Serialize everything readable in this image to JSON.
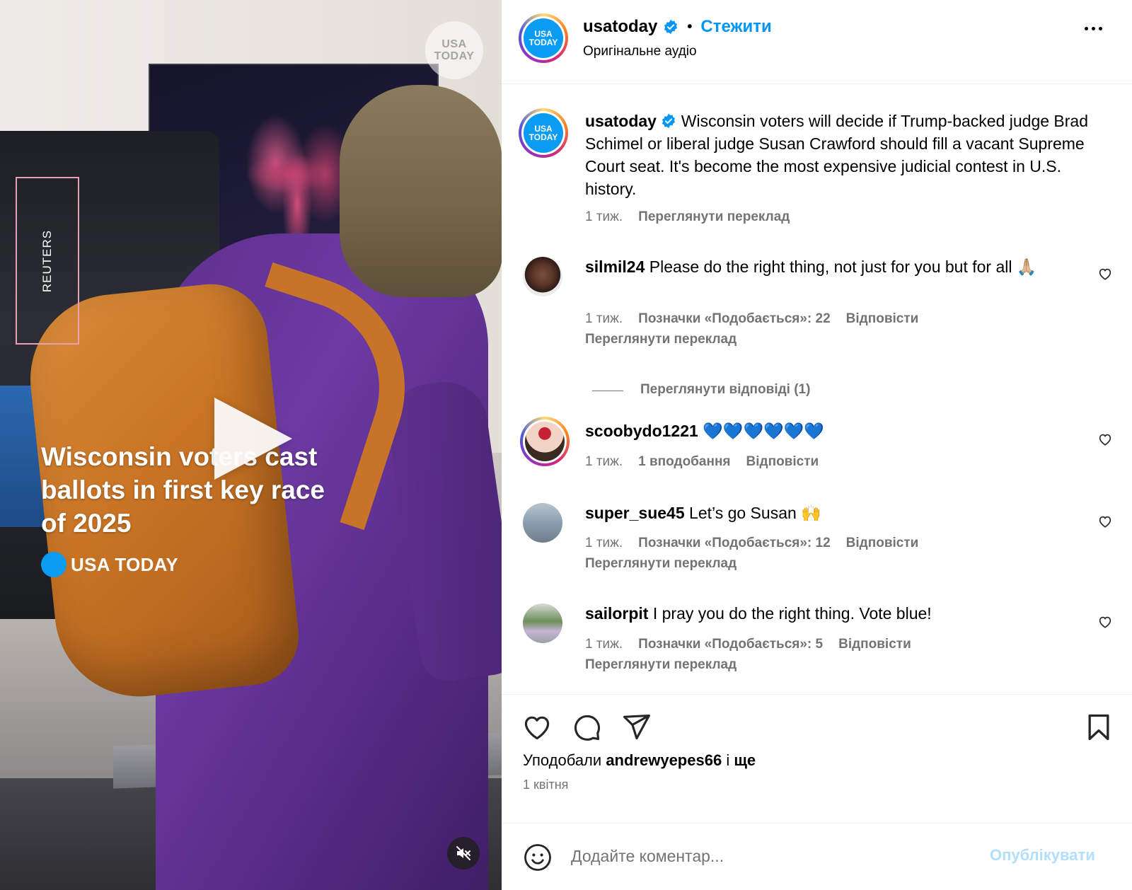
{
  "video": {
    "watermark_line1": "USA",
    "watermark_line2": "TODAY",
    "credit": "REUTERS",
    "headline": "Wisconsin voters cast ballots in first key race of 2025",
    "brand": "USA TODAY",
    "play_icon": "play-icon",
    "mute_icon": "muted-speaker-icon"
  },
  "header": {
    "username": "usatoday",
    "separator": "•",
    "follow_label": "Стежити",
    "subtitle": "Оригінальне аудіо",
    "avatar_line1": "USA",
    "avatar_line2": "TODAY",
    "more_icon": "more-options-icon"
  },
  "caption": {
    "username": "usatoday",
    "text": "Wisconsin voters will decide if Trump-backed judge Brad Schimel or liberal judge Susan Crawford should fill a vacant Supreme Court seat. It's become the most expensive judicial contest in U.S. history.",
    "time": "1 тиж.",
    "translate": "Переглянути переклад"
  },
  "comments": [
    {
      "username": "silmil24",
      "text": "Please do the right thing, not just for you but for all 🙏🏼",
      "time": "1 тиж.",
      "likes": "Позначки «Подобається»: 22",
      "reply": "Відповісти",
      "translate": "Переглянути переклад",
      "view_replies": "Переглянути відповіді (1)"
    },
    {
      "username": "scoobydo1221",
      "text": "💙💙💙💙💙💙",
      "time": "1 тиж.",
      "likes": "1 вподобання",
      "reply": "Відповісти"
    },
    {
      "username": "super_sue45",
      "text": "Let’s go Susan 🙌",
      "time": "1 тиж.",
      "likes": "Позначки «Подобається»: 12",
      "reply": "Відповісти",
      "translate": "Переглянути переклад"
    },
    {
      "username": "sailorpit",
      "text": "I pray you do the right thing. Vote blue!",
      "time": "1 тиж.",
      "likes": "Позначки «Подобається»: 5",
      "reply": "Відповісти",
      "translate": "Переглянути переклад"
    }
  ],
  "actions": {
    "liked_prefix": "Уподобали",
    "liked_user": "andrewyepes66",
    "liked_and": "і",
    "liked_more": "ще",
    "date": "1 квітня"
  },
  "comment_box": {
    "placeholder": "Додайте коментар...",
    "publish": "Опублікувати"
  },
  "colors": {
    "accent": "#0095f6",
    "publish_disabled": "#b2dffc",
    "secondary_text": "#737373",
    "brand_blue": "#0a9bf3"
  }
}
